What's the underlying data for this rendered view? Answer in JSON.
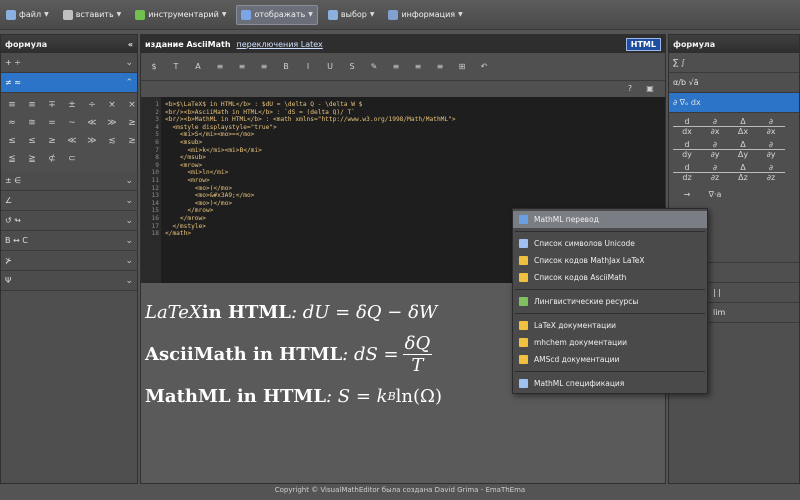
{
  "menubar": {
    "items": [
      {
        "label": "файл",
        "icon": "file-icon"
      },
      {
        "label": "вставить",
        "icon": "insert-icon"
      },
      {
        "label": "инструментарий",
        "icon": "tools-icon"
      },
      {
        "label": "отображать",
        "icon": "display-icon",
        "active": true
      },
      {
        "label": "выбор",
        "icon": "select-icon"
      },
      {
        "label": "информация",
        "icon": "info-icon"
      }
    ]
  },
  "left_panel": {
    "title": "формула",
    "collapse": "«",
    "sections": [
      "+  ÷",
      "≠  ≈",
      "±  ∈",
      "∠",
      "↺  ↬",
      "B ↔ C",
      "⊁",
      "Ψ"
    ],
    "symbols": [
      "≡",
      "≡",
      "∓",
      "±",
      "÷",
      "×",
      "×",
      "≈",
      "≅",
      "=",
      "~",
      "≪",
      "≫",
      "≥",
      "≤",
      "≤",
      "≥",
      "≪",
      "≫",
      "≲",
      "≳",
      "≦",
      "≧",
      "⊄",
      "⊂"
    ]
  },
  "center": {
    "title": "издание AsciiMath",
    "switch_link": "переключения Latex",
    "badge": "HTML",
    "toolbar": [
      "$",
      "T",
      "A",
      "≡",
      "≡",
      "≡",
      "B",
      "I",
      "U",
      "S",
      "✎",
      "≡",
      "≡",
      "≡",
      "⊞",
      "↶"
    ],
    "line_numbers": [
      "1",
      "2",
      "3",
      "4",
      "5",
      "6",
      "7",
      "8",
      "9",
      "10",
      "11",
      "12",
      "13",
      "14",
      "15",
      "16",
      "17",
      "18"
    ],
    "code_lines": [
      "<b>$\\LaTeX$ in HTML</b> : $dU = \\delta Q - \\delta W $",
      "<br/><b>AsciiMath in HTML</b> : `dS = (delta Q)/ T`",
      "<br/><b>MathML in HTML</b> : <math xmlns=\"http://www.w3.org/1998/Math/MathML\">",
      "  <mstyle displaystyle=\"true\">",
      "    <mi>S</mi><mo>=</mo>",
      "    <msub>",
      "      <mi>k</mi><mi>B</mi>",
      "    </msub>",
      "    <mrow>",
      "      <mi>ln</mi>",
      "      <mrow>",
      "        <mo>(</mo>",
      "        <mo>&#x3A9;</mo>",
      "        <mo>)</mo>",
      "      </mrow>",
      "    </mrow>",
      "  </mstyle>",
      "</math>"
    ],
    "preview": {
      "line1_prefix": "LaTeX",
      "line1_bold": " in HTML",
      "line1_math": " : dU = δQ − δW",
      "line2_bold": "AsciiMath in HTML",
      "line2_math": " : dS = ",
      "line2_num": "δQ",
      "line2_den": "T",
      "line3_bold": "MathML in HTML",
      "line3_math": " : S = k",
      "line3_sub": "B",
      "line3_tail": " ln(Ω)"
    }
  },
  "right_panel": {
    "title": "формула",
    "rows": [
      "∑  ∫",
      "α/b  √ā",
      "∂  ∇ₒ  dx"
    ],
    "derivs": [
      {
        "n": "d",
        "d": "dx"
      },
      {
        "n": "∂",
        "d": "∂x"
      },
      {
        "n": "Δ",
        "d": "Δx"
      },
      {
        "n": "∂",
        "d": "∂x"
      },
      {
        "n": "d",
        "d": "dy"
      },
      {
        "n": "∂",
        "d": "∂y"
      },
      {
        "n": "Δ",
        "d": "Δy"
      },
      {
        "n": "∂",
        "d": "∂y"
      },
      {
        "n": "d",
        "d": "dz"
      },
      {
        "n": "∂",
        "d": "∂z"
      },
      {
        "n": "Δ",
        "d": "Δz"
      },
      {
        "n": "∂",
        "d": "∂z"
      }
    ],
    "extra1": "→",
    "extra2": "∇·a",
    "bottom1": "| |",
    "bottom2": "lim"
  },
  "context_menu": {
    "items": [
      {
        "label": "MathML перевод",
        "icon": "translate-icon",
        "highlight": true,
        "color": "#6aa0e0"
      },
      {
        "sep": true
      },
      {
        "label": "Список символов Unicode",
        "icon": "unicode-list-icon",
        "color": "#9fc0f0"
      },
      {
        "label": "Список кодов MathJax LaTeX",
        "icon": "mathjax-list-icon",
        "color": "#f0c040"
      },
      {
        "label": "Список кодов AsciiMath",
        "icon": "asciimath-list-icon",
        "color": "#f0c040"
      },
      {
        "sep": true
      },
      {
        "label": "Лингвистические ресурсы",
        "icon": "globe-icon",
        "color": "#80c060"
      },
      {
        "sep": true
      },
      {
        "label": "LaTeX документации",
        "icon": "latex-doc-icon",
        "color": "#f0c040"
      },
      {
        "label": "mhchem документации",
        "icon": "mhchem-doc-icon",
        "color": "#f0c040"
      },
      {
        "label": "AMScd документации",
        "icon": "amscd-doc-icon",
        "color": "#f0c040"
      },
      {
        "sep": true
      },
      {
        "label": "MathML спецификация",
        "icon": "mathml-spec-icon",
        "color": "#9fc0f0"
      }
    ]
  },
  "footer": {
    "text": "Copyright © VisualMathEditor была создана David Grima - EmaThEma"
  },
  "colors": {
    "accent": "#2b74c8",
    "menu_highlight": "#7a7d84"
  }
}
